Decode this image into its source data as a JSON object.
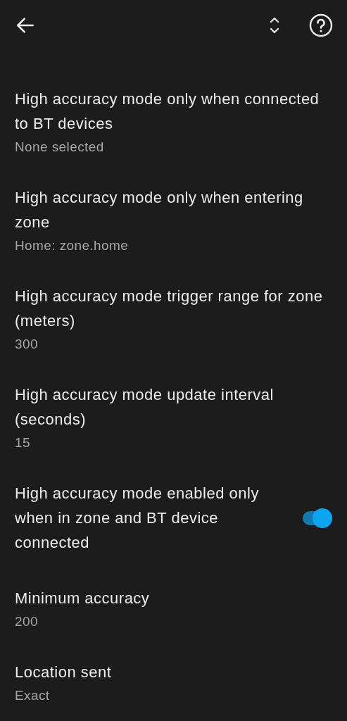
{
  "settings": [
    {
      "kind": "text",
      "title": "High accuracy mode only when connected to BT devices",
      "summary": "None selected"
    },
    {
      "kind": "text",
      "title": "High accuracy mode only when entering zone",
      "summary": "Home: zone.home"
    },
    {
      "kind": "text",
      "title": "High accuracy mode trigger range for zone (meters)",
      "summary": "300"
    },
    {
      "kind": "text",
      "title": "High accuracy mode update interval (seconds)",
      "summary": "15"
    },
    {
      "kind": "switch",
      "title": "High accuracy mode enabled only when in zone and BT device connected",
      "on": true
    },
    {
      "kind": "text",
      "title": "Minimum accuracy",
      "summary": "200"
    },
    {
      "kind": "text",
      "title": "Location sent",
      "summary": "Exact"
    }
  ]
}
